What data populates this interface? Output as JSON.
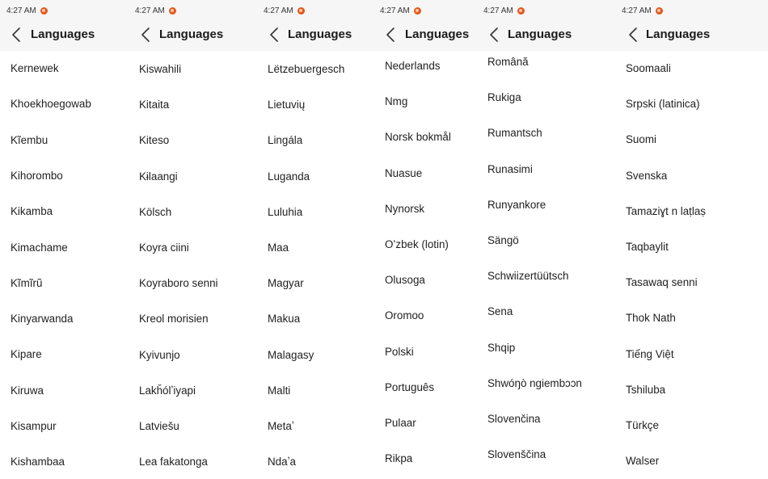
{
  "panels": [
    {
      "time": "4:27 AM",
      "title": "Languages",
      "items": [
        "Kernewek",
        "Khoekhoegowab",
        "Kĩembu",
        "Kihorombo",
        "Kikamba",
        "Kimachame",
        "Kĩmĩrũ",
        "Kinyarwanda",
        "Kipare",
        "Kiruwa",
        "Kisampur",
        "Kishambaa"
      ]
    },
    {
      "time": "4:27 AM",
      "title": "Languages",
      "items": [
        "Kiswahili",
        "Kitaita",
        "Kiteso",
        "Kɨlaangi",
        "Kölsch",
        "Koyra ciini",
        "Koyraboro senni",
        "Kreol morisien",
        "Kyivunjo",
        "Lakȟólʼiyapi",
        "Latviešu",
        "Lea fakatonga"
      ]
    },
    {
      "time": "4:27 AM",
      "title": "Languages",
      "items": [
        "Lëtzebuergesch",
        "Lietuvių",
        "Lingála",
        "Luganda",
        "Luluhia",
        "Maa",
        "Magyar",
        "Makua",
        "Malagasy",
        "Malti",
        "Metaʼ",
        "Ndaʼa"
      ]
    },
    {
      "time": "4:27 AM",
      "title": "Languages",
      "items": [
        "Nederlands",
        "Nmg",
        "Norsk bokmål",
        "Nuasue",
        "Nynorsk",
        "Oʻzbek (lotin)",
        "Olusoga",
        "Oromoo",
        "Polski",
        "Português",
        "Pulaar",
        "Rikpa"
      ]
    },
    {
      "time": "4:27 AM",
      "title": "Languages",
      "items": [
        "Română",
        "Rukiga",
        "Rumantsch",
        "Runasimi",
        "Runyankore",
        "Sängö",
        "Schwiizertüütsch",
        "Sena",
        "Shqip",
        "Shwóŋò ngiembɔɔn",
        "Slovenčina",
        "Slovenščina"
      ]
    },
    {
      "time": "4:27 AM",
      "title": "Languages",
      "items": [
        "Soomaali",
        "Srpski (latinica)",
        "Suomi",
        "Svenska",
        "Tamaziɣt n laṭlaṣ",
        "Taqbaylit",
        "Tasawaq senni",
        "Thok Nath",
        "Tiếng Việt",
        "Tshiluba",
        "Türkçe",
        "Walser"
      ]
    }
  ],
  "colors": {
    "header_bg": "#f6f6f6",
    "notification_dot": "#e2571e"
  },
  "icons": {
    "back": "chevron-left-icon",
    "notification": "notification-dot-icon"
  }
}
